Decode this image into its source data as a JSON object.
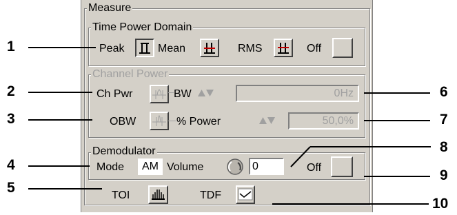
{
  "measure": {
    "title": "Measure",
    "time_power": {
      "title": "Time Power Domain",
      "peak_label": "Peak",
      "mean_label": "Mean",
      "rms_label": "RMS",
      "off_label": "Off"
    },
    "channel_power": {
      "title": "Channel Power",
      "ch_pwr_label": "Ch Pwr",
      "bw_label": "BW",
      "bw_value": "0Hz",
      "obw_label": "OBW",
      "pct_power_label": "% Power",
      "pct_power_value": "50,0%"
    },
    "demodulator": {
      "title": "Demodulator",
      "mode_label": "Mode",
      "mode_value": "AM",
      "volume_label": "Volume",
      "volume_value": "0",
      "off_label": "Off"
    },
    "toi_label": "TOI",
    "tdf_label": "TDF"
  },
  "callouts": [
    "1",
    "2",
    "3",
    "4",
    "5",
    "6",
    "7",
    "8",
    "9",
    "10"
  ]
}
